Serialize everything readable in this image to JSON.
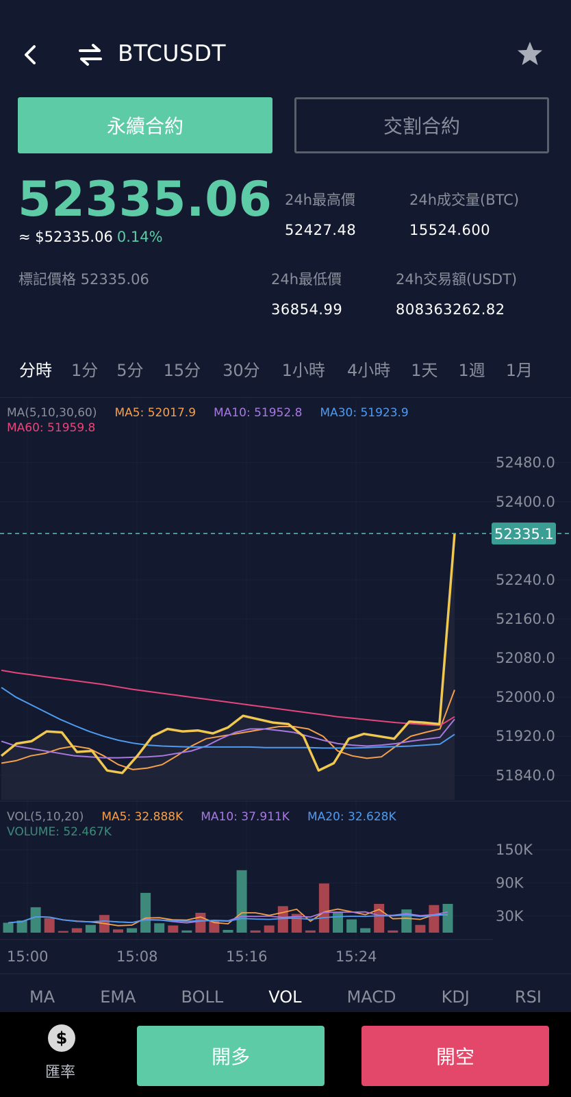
{
  "header": {
    "symbol": "BTCUSDT",
    "back_icon": "chevron-left-icon",
    "swap_icon": "swap-arrows-icon",
    "favorite_icon": "star-icon"
  },
  "contract_tabs": {
    "perpetual": "永續合約",
    "delivery": "交割合約"
  },
  "ticker": {
    "last_price": "52335.06",
    "usd_price": "≈ $52335.06",
    "change_pct": "0.14%",
    "mark_price": "標記價格 52335.06",
    "high_label": "24h最高價",
    "high_value": "52427.48",
    "volume_label": "24h成交量(BTC)",
    "volume_value": "15524.600",
    "low_label": "24h最低價",
    "low_value": "36854.99",
    "turnover_label": "24h交易額(USDT)",
    "turnover_value": "808363262.82"
  },
  "periods": [
    "分時",
    "1分",
    "5分",
    "15分",
    "30分",
    "1小時",
    "4小時",
    "1天",
    "1週",
    "1月"
  ],
  "active_period": "分時",
  "ma_legend": {
    "title": "MA(5,10,30,60)",
    "ma5": "MA5: 52017.9",
    "ma10": "MA10: 51952.8",
    "ma30": "MA30: 51923.9",
    "ma60": "MA60: 51959.8"
  },
  "vol_legend": {
    "title": "VOL(5,10,20)",
    "ma5": "MA5: 32.888K",
    "ma10": "MA10: 37.911K",
    "ma20": "MA20: 32.628K",
    "volume": "VOLUME: 52.467K"
  },
  "colors": {
    "background": "#131a30",
    "up": "#5ccba6",
    "down": "#e3476a",
    "price_line": "#f0c850",
    "ma5": "#f5a04a",
    "ma10": "#a879e0",
    "ma30": "#4f9bef",
    "ma60": "#e8457a",
    "vol_up": "#3e8a7a",
    "vol_down": "#a8454f"
  },
  "chart_data": [
    {
      "type": "line",
      "name": "price",
      "y_ticks": [
        "52480.0",
        "52400.0",
        "52240.0",
        "52160.0",
        "52080.0",
        "52000.0",
        "51920.0",
        "51840.0"
      ],
      "last_price_tag": "52335.1",
      "x_ticks": [
        "15:00",
        "15:08",
        "15:16",
        "15:24"
      ],
      "ylim": [
        51790,
        52530
      ],
      "series": [
        {
          "name": "MA5",
          "color": "#f5a04a",
          "values": [
            51865,
            51870,
            51880,
            51885,
            51895,
            51900,
            51895,
            51880,
            51862,
            51852,
            51855,
            51862,
            51880,
            51900,
            51915,
            51920,
            51925,
            51930,
            51935,
            51940,
            51940,
            51935,
            51920,
            51890,
            51880,
            51875,
            51878,
            51900,
            51920,
            51928,
            51935,
            52015
          ]
        },
        {
          "name": "MA10",
          "color": "#a879e0",
          "values": [
            51910,
            51900,
            51895,
            51890,
            51885,
            51880,
            51878,
            51876,
            51876,
            51877,
            51878,
            51880,
            51885,
            51890,
            51900,
            51915,
            51928,
            51935,
            51935,
            51932,
            51928,
            51920,
            51912,
            51905,
            51902,
            51900,
            51902,
            51905,
            51910,
            51914,
            51918,
            51955
          ]
        },
        {
          "name": "MA30",
          "color": "#4f9bef",
          "values": [
            52020,
            52000,
            51985,
            51970,
            51955,
            51942,
            51930,
            51920,
            51912,
            51906,
            51902,
            51900,
            51899,
            51898,
            51898,
            51898,
            51898,
            51898,
            51897,
            51897,
            51897,
            51897,
            51896,
            51896,
            51896,
            51897,
            51898,
            51899,
            51900,
            51902,
            51904,
            51924
          ]
        },
        {
          "name": "MA60",
          "color": "#e8457a",
          "values": [
            52055,
            52050,
            52046,
            52042,
            52038,
            52034,
            52030,
            52026,
            52021,
            52016,
            52012,
            52008,
            52004,
            52000,
            51996,
            51992,
            51988,
            51984,
            51980,
            51976,
            51972,
            51968,
            51964,
            51960,
            51957,
            51954,
            51951,
            51948,
            51946,
            51944,
            51942,
            51960
          ]
        },
        {
          "name": "Price",
          "color": "#f0c850",
          "values": [
            51880,
            51905,
            51910,
            51930,
            51928,
            51888,
            51890,
            51850,
            51845,
            51880,
            51920,
            51935,
            51930,
            51932,
            51926,
            51938,
            51962,
            51955,
            51948,
            51945,
            51920,
            51850,
            51865,
            51915,
            51925,
            51920,
            51915,
            51950,
            51948,
            51945,
            52335
          ]
        }
      ]
    },
    {
      "type": "bar",
      "name": "volume",
      "y_ticks": [
        "150K",
        "90K",
        "30K"
      ],
      "ylim": [
        0,
        176
      ],
      "values": [
        18,
        22,
        46,
        26,
        3,
        8,
        14,
        32,
        6,
        8,
        72,
        17,
        13,
        4,
        36,
        22,
        5,
        113,
        4,
        13,
        48,
        34,
        4,
        89,
        38,
        24,
        8,
        52,
        4,
        42,
        14,
        50,
        52
      ],
      "up": [
        true,
        true,
        true,
        false,
        false,
        false,
        true,
        false,
        false,
        true,
        true,
        true,
        false,
        true,
        false,
        false,
        true,
        true,
        false,
        false,
        false,
        false,
        false,
        false,
        true,
        true,
        true,
        false,
        false,
        true,
        false,
        false,
        true
      ]
    }
  ],
  "indicators": [
    "MA",
    "EMA",
    "BOLL",
    "VOL",
    "MACD",
    "KDJ",
    "RSI"
  ],
  "active_indicator": "VOL",
  "bottom": {
    "rate_icon_glyph": "$",
    "rate_label": "匯率",
    "long_label": "開多",
    "short_label": "開空"
  }
}
